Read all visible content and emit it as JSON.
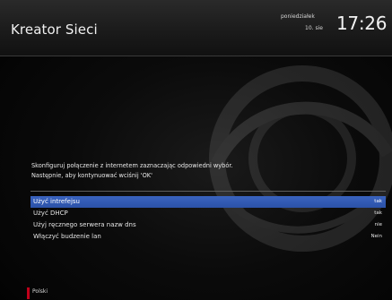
{
  "header": {
    "title": "Kreator Sieci",
    "day": "poniedziałek",
    "date": "10. sie",
    "time": "17:26"
  },
  "description": {
    "line1": "Skonfiguruj połączenie z internetem zaznaczając odpowiedni wybór.",
    "line2": "Następnie, aby kontynuować wciśnij 'OK'"
  },
  "menu": {
    "items": [
      {
        "label": "Użyć intrefejsu",
        "value": "tak"
      },
      {
        "label": "Użyć DHCP",
        "value": "tak"
      },
      {
        "label": "Użyj ręcznego serwera nazw dns",
        "value": "nie"
      },
      {
        "label": "Włączyć budzenie lan",
        "value": "Nein"
      }
    ]
  },
  "footer": {
    "language": "Polski"
  },
  "colors": {
    "selection": "#2f58b0",
    "red_key": "#c0001a"
  }
}
